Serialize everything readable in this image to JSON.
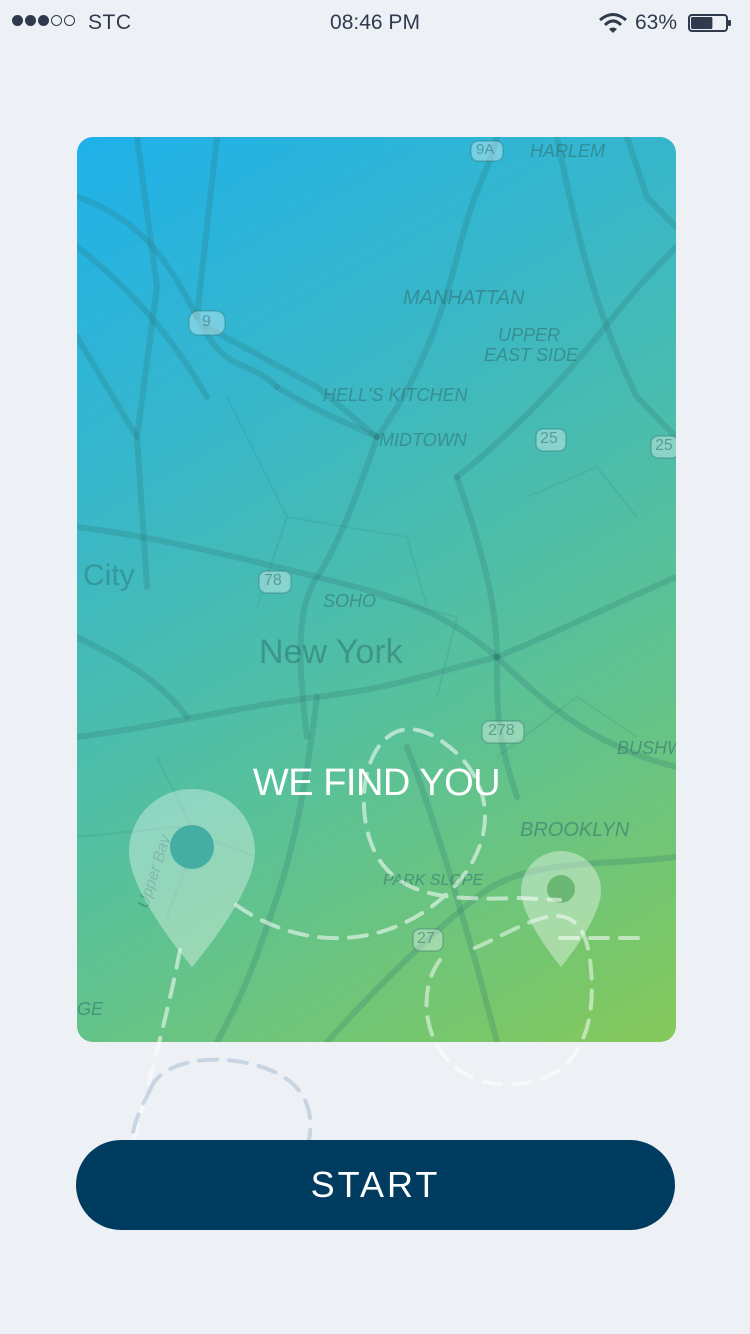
{
  "status_bar": {
    "signal_filled": 3,
    "signal_total": 5,
    "carrier": "STC",
    "time": "08:46 PM",
    "battery_percent": "63%",
    "battery_level": 0.63,
    "icons": [
      "signal-dots-icon",
      "wifi-icon",
      "battery-icon"
    ]
  },
  "card": {
    "headline": "WE FIND YOU",
    "colors": {
      "gradient_start": "#1fb1ea",
      "gradient_end": "#85c95a"
    },
    "map_labels": {
      "harlem": "HARLEM",
      "manhattan": "MANHATTAN",
      "upper_east_side_1": "UPPER",
      "upper_east_side_2": "EAST SIDE",
      "hells_kitchen": "HELL'S KITCHEN",
      "midtown": "MIDTOWN",
      "city": "City",
      "soho": "SOHO",
      "new_york": "New York",
      "bushwick": "BUSHW",
      "brooklyn": "BROOKLYN",
      "park_slope": "PARK SLOPE",
      "upper_bay": "Upper Bay",
      "edge_ge": "GE"
    },
    "route_shields": {
      "r9a": "9A",
      "r9": "9",
      "r25a": "25",
      "r25b": "25",
      "r78": "78",
      "r278": "278",
      "r27": "27"
    },
    "icons": [
      "location-pin-icon",
      "location-pin-icon"
    ]
  },
  "start_button": {
    "label": "START",
    "color": "#003c5f"
  }
}
